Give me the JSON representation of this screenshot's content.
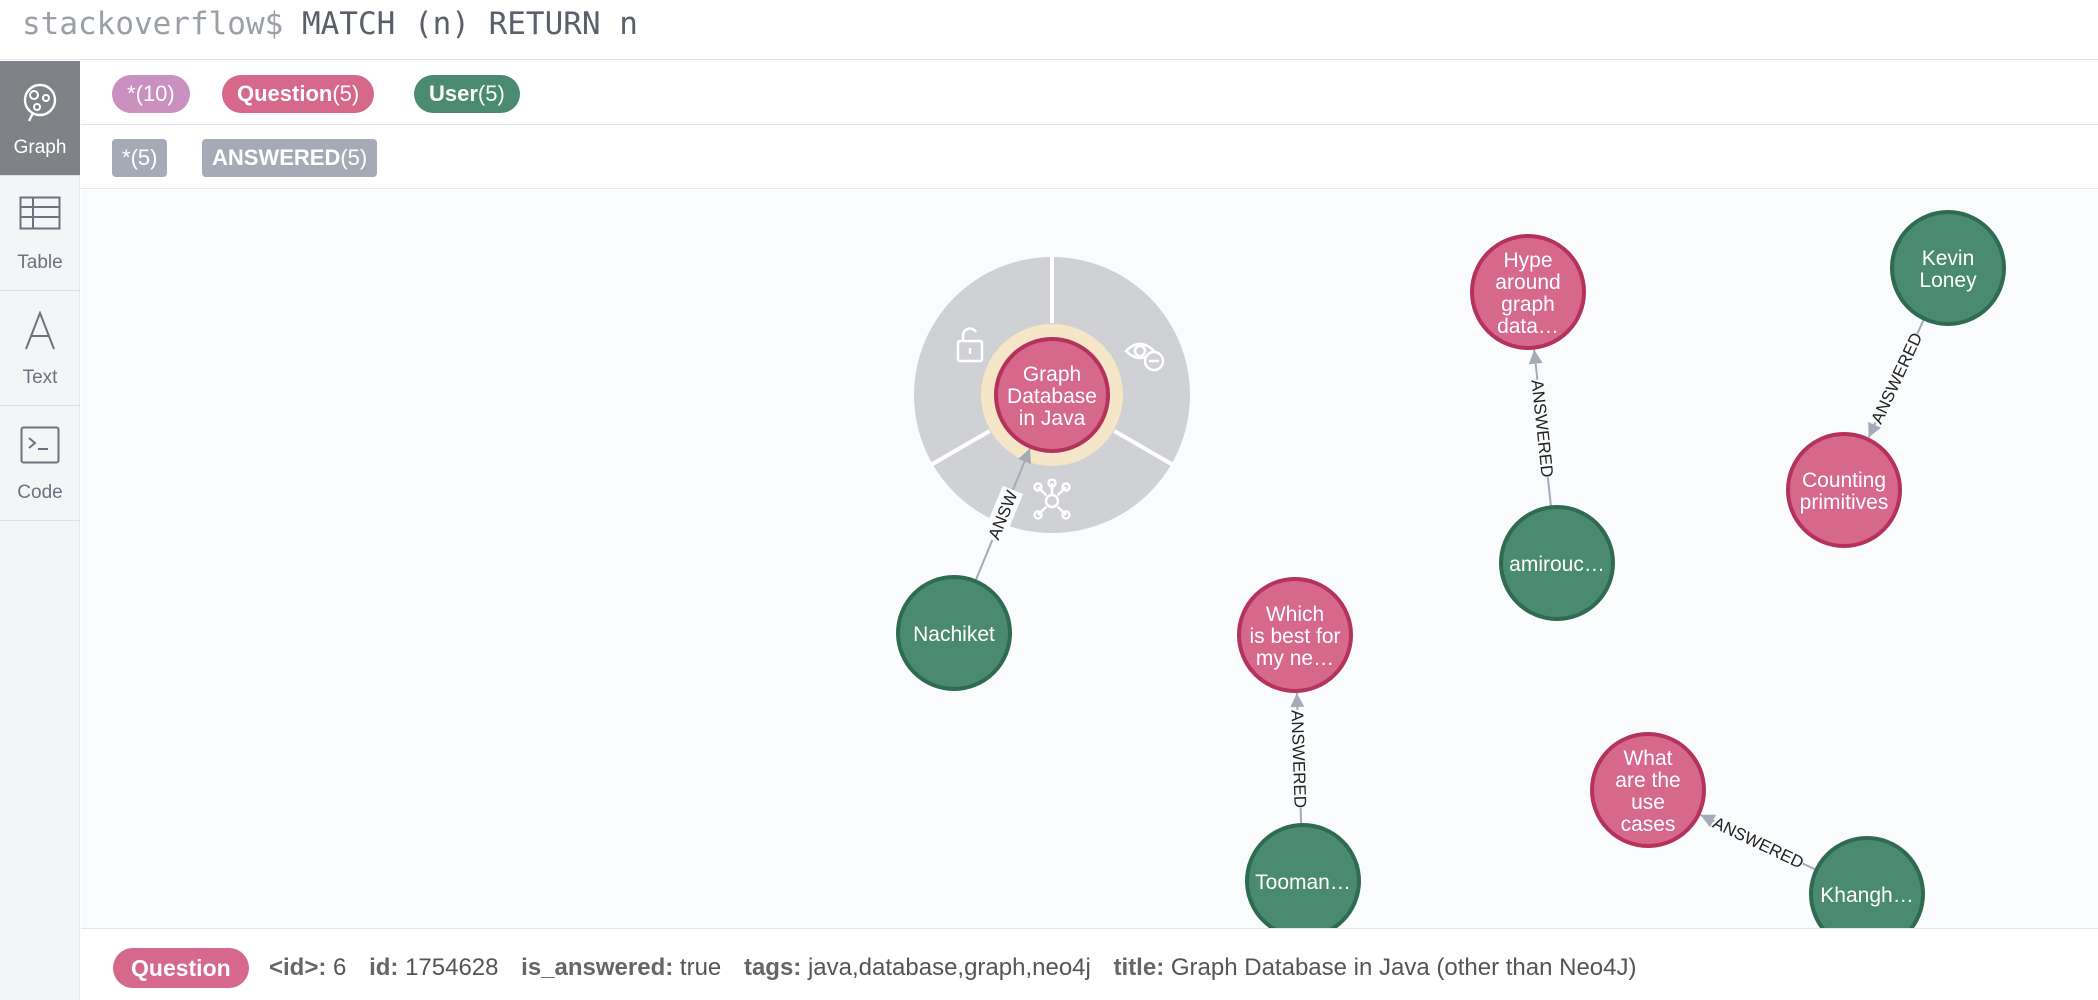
{
  "colors": {
    "question": "#d5688b",
    "question_border": "#b4325c",
    "user": "#4a8a70",
    "user_border": "#2f6a52",
    "all_nodes": "#c990c0",
    "relationship": "#a5abb6",
    "ring": "#f5e6c8",
    "menu": "#cfd1d4"
  },
  "query": {
    "prompt": "stackoverflow$",
    "command": "MATCH (n) RETURN n"
  },
  "sidebar": {
    "items": [
      {
        "label": "Graph",
        "icon": "graph-icon",
        "active": true
      },
      {
        "label": "Table",
        "icon": "table-icon",
        "active": false
      },
      {
        "label": "Text",
        "icon": "text-icon",
        "active": false
      },
      {
        "label": "Code",
        "icon": "code-icon",
        "active": false
      }
    ]
  },
  "labels": [
    {
      "name": "*",
      "count": "(10)"
    },
    {
      "name": "Question",
      "count": "(5)"
    },
    {
      "name": "User",
      "count": "(5)"
    }
  ],
  "relationships": [
    {
      "name": "*",
      "count": "(5)"
    },
    {
      "name": "ANSWERED",
      "count": "(5)"
    }
  ],
  "graph": {
    "nodes": [
      {
        "id": "q1",
        "type": "question",
        "lines": [
          "Graph",
          "Database",
          "in Java"
        ],
        "selected": true
      },
      {
        "id": "q2",
        "type": "question",
        "lines": [
          "Hype",
          "around",
          "graph",
          "data…"
        ]
      },
      {
        "id": "q3",
        "type": "question",
        "lines": [
          "Counting",
          "primitives"
        ]
      },
      {
        "id": "q4",
        "type": "question",
        "lines": [
          "Which",
          "is best for",
          "my ne…"
        ]
      },
      {
        "id": "q5",
        "type": "question",
        "lines": [
          "What",
          "are the",
          "use",
          "cases"
        ]
      },
      {
        "id": "u1",
        "type": "user",
        "lines": [
          "Nachiket"
        ]
      },
      {
        "id": "u2",
        "type": "user",
        "lines": [
          "amirouc…"
        ]
      },
      {
        "id": "u3",
        "type": "user",
        "lines": [
          "Kevin",
          "Loney"
        ]
      },
      {
        "id": "u4",
        "type": "user",
        "lines": [
          "Tooman…"
        ]
      },
      {
        "id": "u5",
        "type": "user",
        "lines": [
          "Khangh…"
        ]
      }
    ],
    "edges": [
      {
        "from": "u1",
        "to": "q1",
        "label": "ANSW"
      },
      {
        "from": "u2",
        "to": "q2",
        "label": "ANSWERED"
      },
      {
        "from": "u3",
        "to": "q3",
        "label": "ANSWERED"
      },
      {
        "from": "u4",
        "to": "q4",
        "label": "ANSWERED"
      },
      {
        "from": "u5",
        "to": "q5",
        "label": "ANSWERED"
      }
    ],
    "context_menu": [
      "unlock-icon",
      "hide-icon",
      "expand-icon"
    ]
  },
  "inspector": {
    "label": "Question",
    "props": [
      {
        "key": "<id>:",
        "value": "6"
      },
      {
        "key": "id:",
        "value": "1754628"
      },
      {
        "key": "is_answered:",
        "value": "true"
      },
      {
        "key": "tags:",
        "value": "java,database,graph,neo4j"
      },
      {
        "key": "title:",
        "value": "Graph Database in Java (other than Neo4J)"
      }
    ]
  }
}
